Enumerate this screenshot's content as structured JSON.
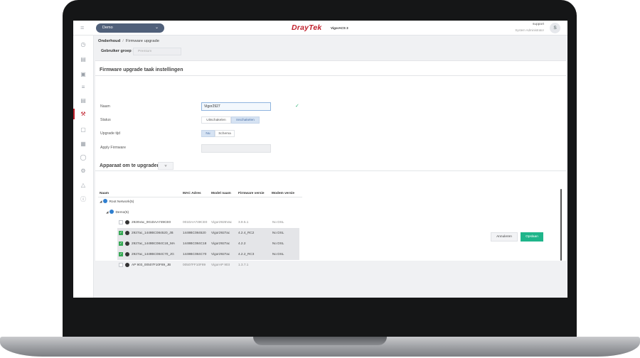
{
  "header": {
    "menu_icon": "hamburger-icon",
    "profile_select": "Demo",
    "brand": "DrayTek",
    "product": "VigorACS 3",
    "user_name": "support",
    "user_role": "System Administrator",
    "avatar_initial": "S",
    "brand_color": "#c0202c"
  },
  "sidebar": {
    "icons": [
      "dashboard-icon",
      "chart-icon",
      "monitor-icon",
      "sliders-icon",
      "printer-icon",
      "wrench-icon",
      "display-icon",
      "save-icon",
      "globe-icon",
      "settings-icon",
      "warning-icon",
      "info-icon"
    ],
    "active": "wrench-icon"
  },
  "breadcrumb": {
    "section": "Onderhoud",
    "separator": "/",
    "page": "Firmware upgrade"
  },
  "group": {
    "label": "Gebruiker groep :",
    "value": "Premium"
  },
  "task_settings": {
    "title": "Firmware upgrade taak instellingen",
    "name_label": "Naam",
    "name_value": "Vigor2927",
    "status_label": "Status",
    "status_options": [
      "Uitschakelen",
      "Inschakelen"
    ],
    "status_selected": "Inschakelen",
    "upgrade_time_label": "Upgrade tijd",
    "upgrade_time_options": [
      "Nu",
      "Schema"
    ],
    "upgrade_time_selected": "Nu",
    "apply_firmware_label": "Apply Firmware",
    "apply_firmware_value": ""
  },
  "devices": {
    "title": "Apparaat om te upgraden",
    "filter_icon": "filter-icon",
    "columns": [
      "Naam",
      "MAC Adres",
      "Model naam",
      "Firmware versie",
      "Modem versie"
    ],
    "root": "Root Network(5)",
    "group": "Demo(5)",
    "rows": [
      {
        "name": "2926Vac_001DAA749CE0",
        "mac": "001DAA749CE0",
        "model": "Vigor2926Vac",
        "firmware": "3.9.5.1",
        "modem": "No DSL",
        "selected": false
      },
      {
        "name": "2927ac_1449BC084520_JB",
        "mac": "1449BC084520",
        "model": "Vigor2927ac",
        "firmware": "4.2.4_RC2",
        "modem": "No DSL",
        "selected": true
      },
      {
        "name": "2927ac_1449BC084C18_MA",
        "mac": "1449BC084C18",
        "model": "Vigor2927ac",
        "firmware": "4.2.2",
        "modem": "No DSL",
        "selected": true
      },
      {
        "name": "2927ac_1449BC084C70_JG",
        "mac": "1449BC084C70",
        "model": "Vigor2927ac",
        "firmware": "4.2.2_RC3",
        "modem": "No DSL",
        "selected": true
      },
      {
        "name": "AP 903_00507F10F89_JB",
        "mac": "00507FF10F89",
        "model": "VigorAP 903",
        "firmware": "1.3.7.1",
        "modem": "",
        "selected": false
      }
    ]
  },
  "actions": {
    "cancel": "Annuleren",
    "save": "Opslaan",
    "save_color": "#1fb58a"
  }
}
